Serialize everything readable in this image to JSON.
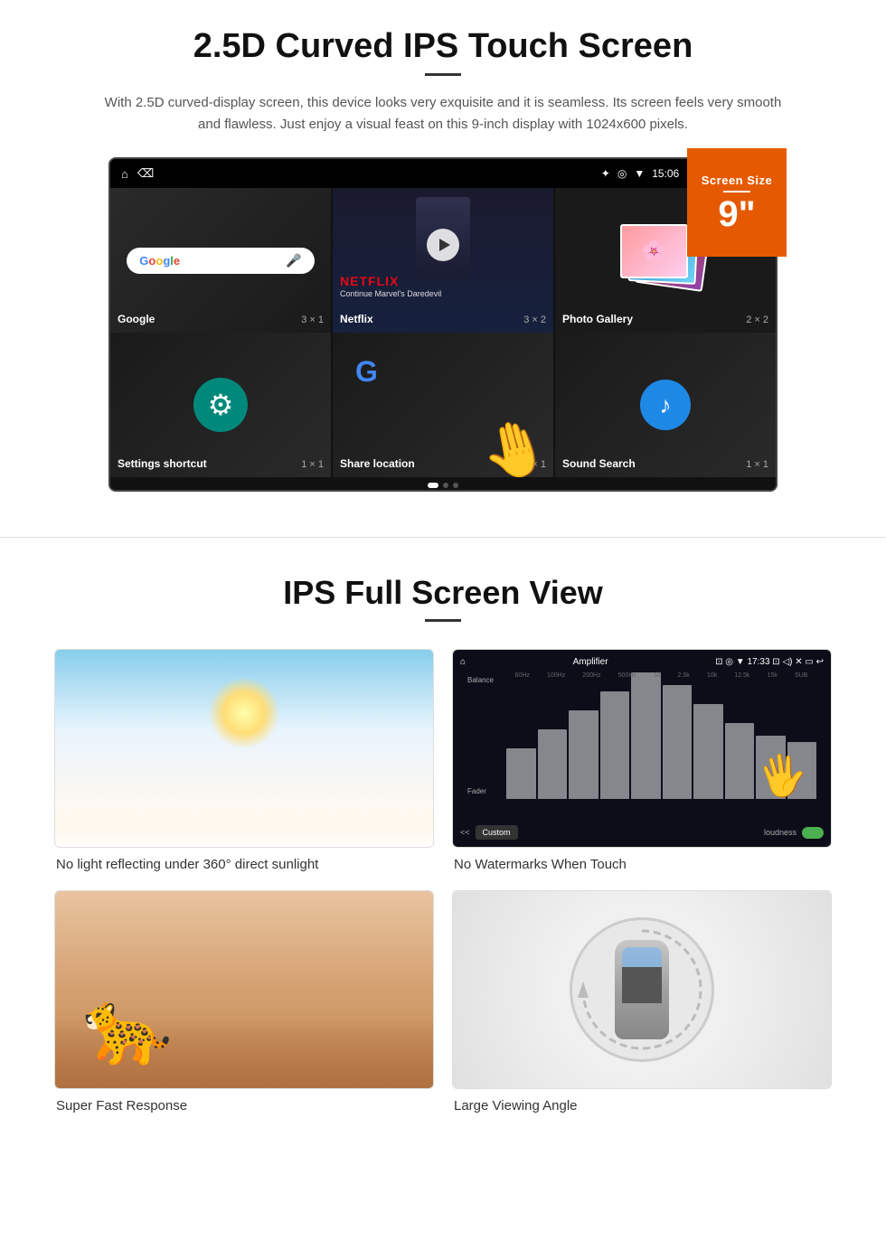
{
  "section1": {
    "title": "2.5D Curved IPS Touch Screen",
    "description": "With 2.5D curved-display screen, this device looks very exquisite and it is seamless. Its screen feels very smooth and flawless. Just enjoy a visual feast on this 9-inch display with 1024x600 pixels.",
    "screen_badge": {
      "label": "Screen Size",
      "value": "9\""
    },
    "status_bar": {
      "time": "15:06"
    },
    "apps": [
      {
        "name": "Google",
        "size": "3 × 1"
      },
      {
        "name": "Netflix",
        "size": "3 × 2"
      },
      {
        "name": "Photo Gallery",
        "size": "2 × 2"
      },
      {
        "name": "Settings shortcut",
        "size": "1 × 1"
      },
      {
        "name": "Share location",
        "size": "1 × 1"
      },
      {
        "name": "Sound Search",
        "size": "1 × 1"
      }
    ],
    "netflix": {
      "logo": "NETFLIX",
      "subtitle": "Continue Marvel's Daredevil"
    }
  },
  "section2": {
    "title": "IPS Full Screen View",
    "features": [
      {
        "label": "No light reflecting under 360° direct sunlight",
        "type": "sky"
      },
      {
        "label": "No Watermarks When Touch",
        "type": "eq"
      },
      {
        "label": "Super Fast Response",
        "type": "cheetah"
      },
      {
        "label": "Large Viewing Angle",
        "type": "car"
      }
    ],
    "eq": {
      "title": "Amplifier",
      "buttons": [
        "Custom",
        "loudness"
      ],
      "bars": [
        40,
        55,
        70,
        85,
        100,
        90,
        75,
        60,
        50,
        45
      ]
    }
  }
}
